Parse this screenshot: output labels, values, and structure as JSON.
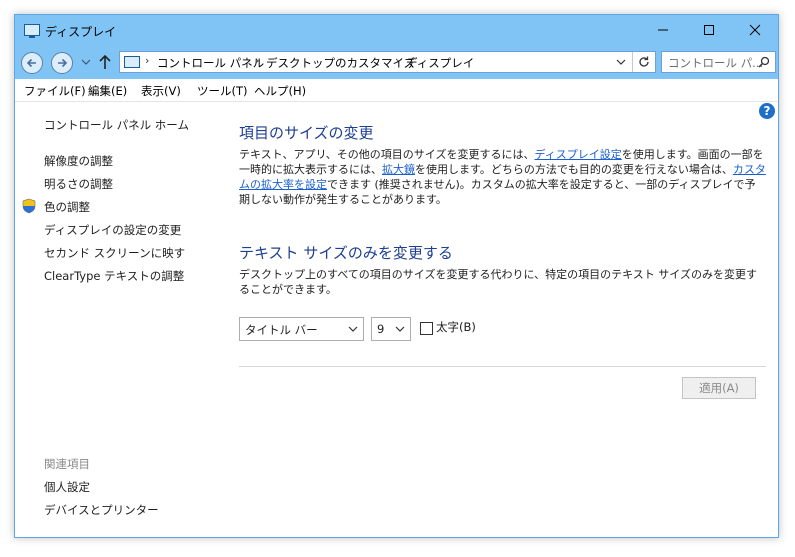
{
  "window": {
    "title": "ディスプレイ"
  },
  "address": {
    "crumbs": [
      "コントロール パネル",
      "デスクトップのカスタマイズ",
      "ディスプレイ"
    ],
    "search_placeholder": "コントロール パ..."
  },
  "menu": [
    "ファイル(F)",
    "編集(E)",
    "表示(V)",
    "ツール(T)",
    "ヘルプ(H)"
  ],
  "sidebar": {
    "home": "コントロール パネル ホーム",
    "items": [
      "解像度の調整",
      "明るさの調整",
      "色の調整",
      "ディスプレイの設定の変更",
      "セカンド スクリーンに映す",
      "ClearType テキストの調整"
    ],
    "related_heading": "関連項目",
    "related": [
      "個人設定",
      "デバイスとプリンター"
    ]
  },
  "section1": {
    "title": "項目のサイズの変更",
    "p1": "テキスト、アプリ、その他の項目のサイズを変更するには、",
    "link1": "ディスプレイ設定",
    "p2": "を使用します。画面の一部を一時的に拡大表示するには、",
    "link2": "拡大鏡",
    "p3": "を使用します。どちらの方法でも目的の変更を行えない場合は、",
    "link3": "カスタムの拡大率を設定",
    "p4": "できます (推奨されません)。カスタムの拡大率を設定すると、一部のディスプレイで予期しない動作が発生することがあります。"
  },
  "section2": {
    "title": "テキスト サイズのみを変更する",
    "desc": "デスクトップ上のすべての項目のサイズを変更する代わりに、特定の項目のテキスト サイズのみを変更することができます。",
    "item_select": "タイトル バー",
    "size_select": "9",
    "bold_label": "太字(B)",
    "bold_checked": false
  },
  "apply_button": "適用(A)",
  "colors": {
    "titlebar": "#7fc4f5",
    "heading": "#1e3f91",
    "link": "#1a5fd0"
  }
}
